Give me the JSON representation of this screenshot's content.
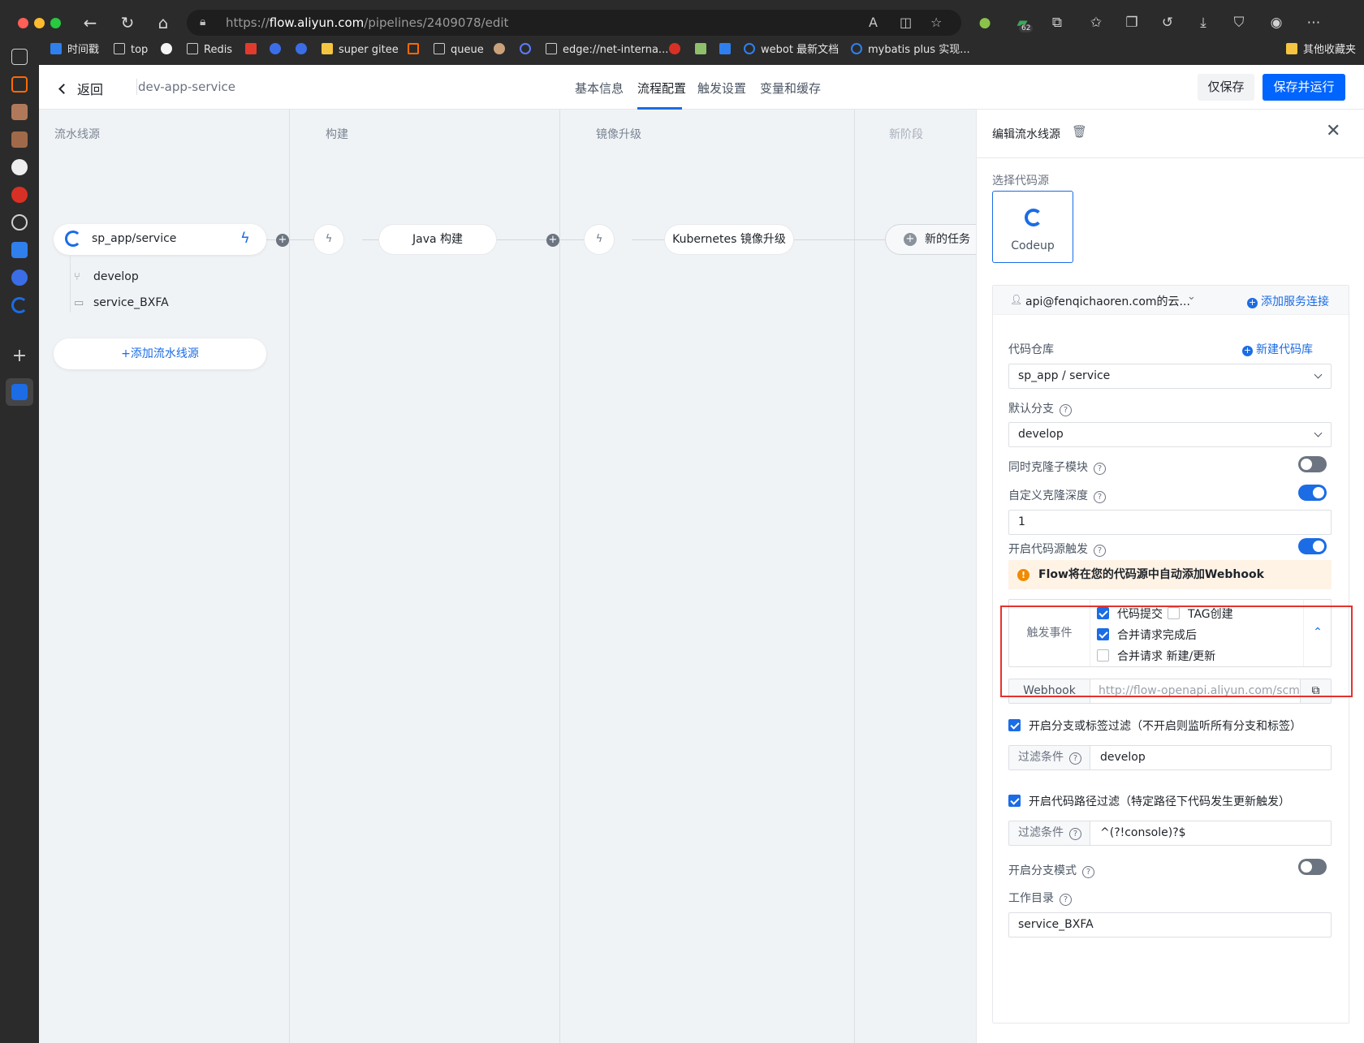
{
  "browser": {
    "url_scheme": "https://",
    "url_host": "flow.aliyun.com",
    "url_path": "/pipelines/2409078/edit",
    "extensions_badge": "62",
    "bookmarks": [
      "时间戳",
      "top",
      "Redis",
      "super gitee",
      "queue",
      "edge://net-interna...",
      "webot 最新文档",
      "mybatis plus 实现...",
      "其他收藏夹"
    ]
  },
  "header": {
    "back_label": "返回",
    "pipeline_name": "dev-app-service",
    "tabs": [
      "基本信息",
      "流程配置",
      "触发设置",
      "变量和缓存"
    ],
    "active_tab": "流程配置",
    "save_only_label": "仅保存",
    "save_run_label": "保存并运行"
  },
  "canvas": {
    "stages": [
      "流水线源",
      "构建",
      "镜像升级",
      "新阶段"
    ],
    "source": {
      "name": "sp_app/service",
      "branch": "develop",
      "workdir": "service_BXFA",
      "add_label": "添加流水线源"
    },
    "jobs": [
      "Java 构建",
      "Kubernetes 镜像升级"
    ],
    "new_task_label": "新的任务"
  },
  "panel": {
    "title": "编辑流水线源",
    "select_source_label": "选择代码源",
    "source_type": "Codeup",
    "account": "api@fenqichaoren.com的云...",
    "add_connection": "添加服务连接",
    "repo_label": "代码仓库",
    "new_repo": "新建代码库",
    "repo_value": "sp_app / service",
    "branch_label": "默认分支",
    "branch_value": "develop",
    "clone_submodule_label": "同时克隆子模块",
    "clone_submodule_on": false,
    "clone_depth_label": "自定义克隆深度",
    "clone_depth_on": true,
    "clone_depth_value": "1",
    "source_trigger_label": "开启代码源触发",
    "source_trigger_on": true,
    "warning": "Flow将在您的代码源中自动添加Webhook",
    "trigger_events_label": "触发事件",
    "events": {
      "commit": {
        "label": "代码提交",
        "checked": true
      },
      "tag": {
        "label": "TAG创建",
        "checked": false
      },
      "merge_done": {
        "label": "合并请求完成后",
        "checked": true
      },
      "merge_new": {
        "label": "合并请求 新建/更新",
        "checked": false
      }
    },
    "webhook_label": "Webhook",
    "webhook_url": "http://flow-openapi.aliyun.com/scm/",
    "branch_filter_label": "开启分支或标签过滤（不开启则监听所有分支和标签）",
    "branch_filter_checked": true,
    "filter_label": "过滤条件",
    "branch_filter_value": "develop",
    "path_filter_label": "开启代码路径过滤（特定路径下代码发生更新触发）",
    "path_filter_checked": true,
    "path_filter_value": "^(?!console)?$",
    "branch_mode_label": "开启分支模式",
    "branch_mode_on": false,
    "workdir_label": "工作目录",
    "workdir_value": "service_BXFA"
  },
  "colors": {
    "primary": "#0064ff",
    "link": "#1b6ce5",
    "highlight": "#e5322d",
    "warning_bg": "#fff3e6"
  }
}
